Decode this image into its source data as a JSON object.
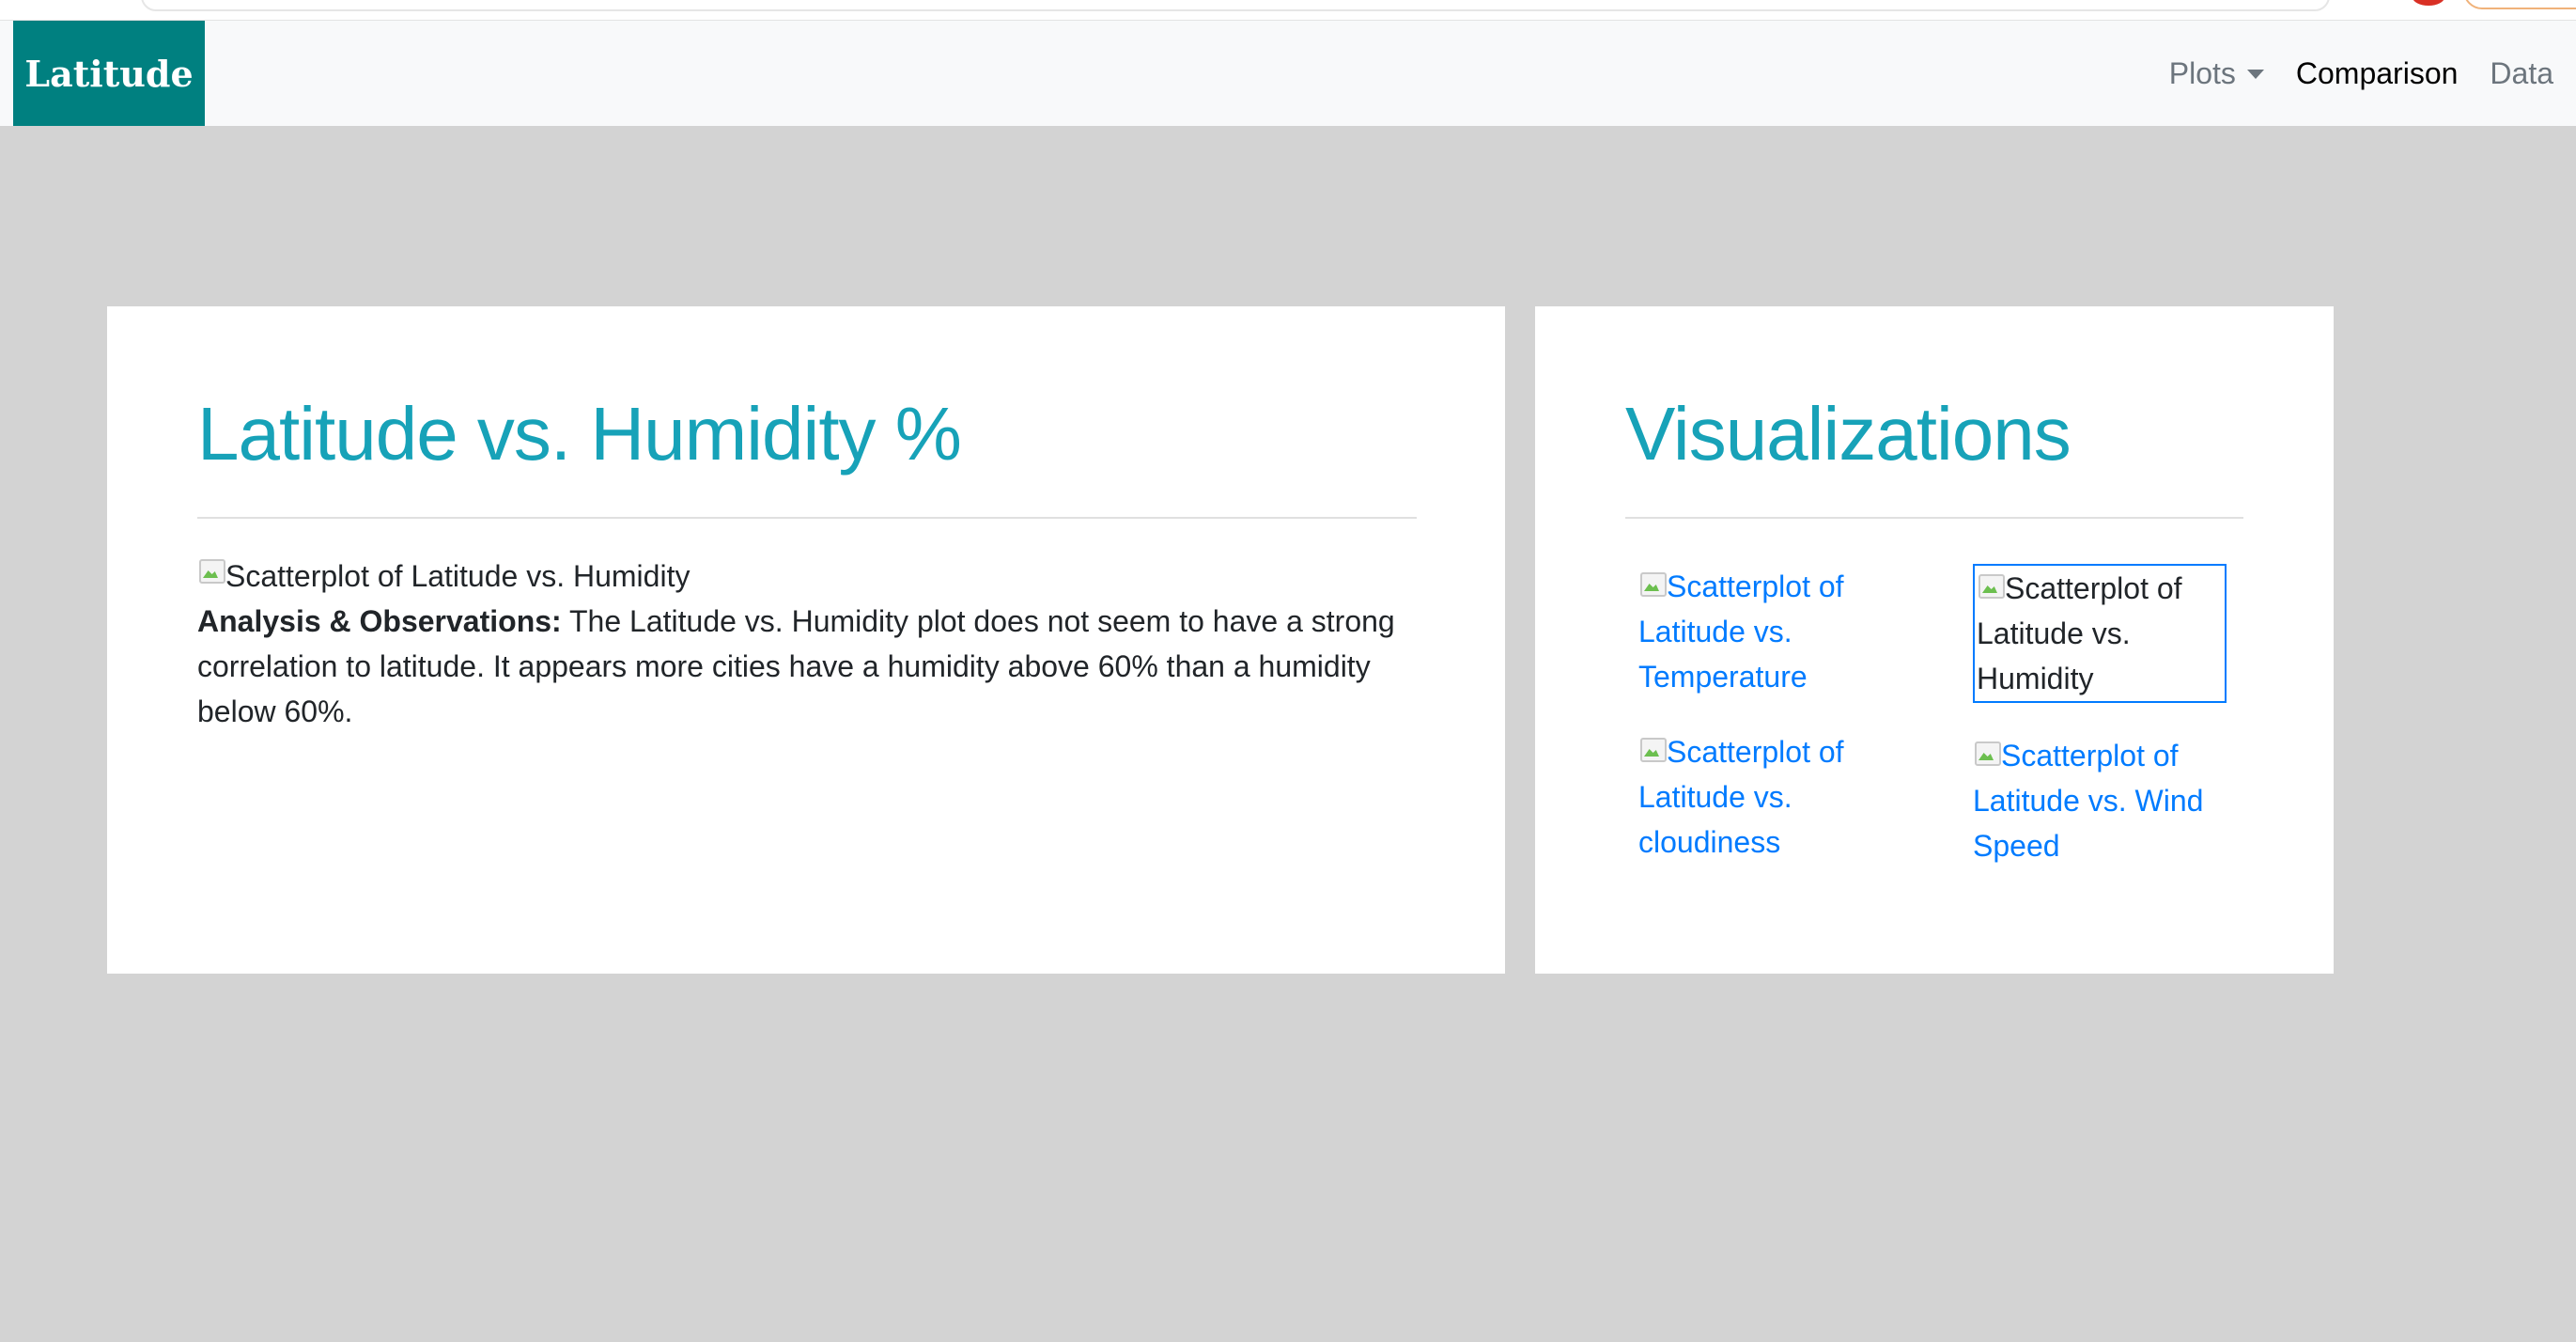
{
  "navbar": {
    "brand": "Latitude",
    "links": [
      {
        "label": "Plots",
        "has_dropdown": true
      },
      {
        "label": "Comparison",
        "active": true
      },
      {
        "label": "Data"
      }
    ]
  },
  "main": {
    "title": "Latitude vs. Humidity %",
    "image_alt": "Scatterplot of Latitude vs. Humidity",
    "analysis_label": "Analysis & Observations:",
    "analysis_text": " The Latitude vs. Humidity plot does not seem to have a strong correlation to latitude. It appears more cities have a humidity above 60% than a humidity below 60%."
  },
  "sidebar": {
    "title": "Visualizations",
    "items": [
      {
        "alt": "Scatterplot of Latitude vs. Temperature"
      },
      {
        "alt": "Scatterplot of Latitude vs. Humidity",
        "selected": true
      },
      {
        "alt": "Scatterplot of Latitude vs. cloudiness"
      },
      {
        "alt": "Scatterplot of Latitude vs. Wind Speed"
      }
    ]
  },
  "colors": {
    "brand_bg": "#008080",
    "title": "#17a2b8",
    "link": "#007bff",
    "page_bg": "#d3d3d3"
  }
}
